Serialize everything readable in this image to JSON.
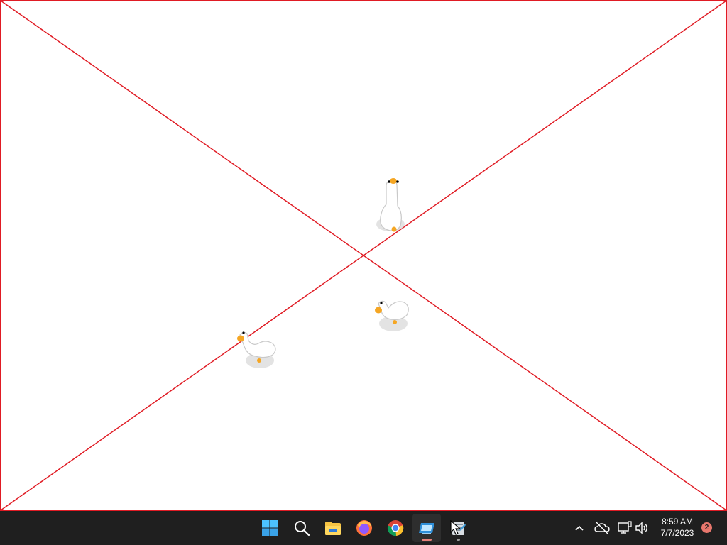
{
  "desktop": {
    "background": "#ffffff",
    "placeholder_border_color": "#e01b24",
    "geese": [
      {
        "name": "goose-standing",
        "pose": "standing-up"
      },
      {
        "name": "goose-walking-left",
        "pose": "walking-left"
      },
      {
        "name": "goose-sitting",
        "pose": "walking-left"
      }
    ]
  },
  "taskbar": {
    "background": "#1f1f1f",
    "apps": [
      {
        "name": "start",
        "icon": "windows-logo-icon"
      },
      {
        "name": "search",
        "icon": "search-icon"
      },
      {
        "name": "file-explorer",
        "icon": "folder-icon"
      },
      {
        "name": "firefox",
        "icon": "firefox-icon"
      },
      {
        "name": "chrome",
        "icon": "chrome-icon"
      },
      {
        "name": "remote-desktop",
        "icon": "monitor-app-icon",
        "active": true
      },
      {
        "name": "goose-app",
        "icon": "notepad-goose-icon",
        "running": true
      }
    ],
    "tray": {
      "icons": [
        "chevron-up-icon",
        "cloud-offline-icon",
        "network-icon",
        "volume-icon"
      ],
      "time": "8:59 AM",
      "date": "7/7/2023",
      "notification_count": "2"
    }
  }
}
